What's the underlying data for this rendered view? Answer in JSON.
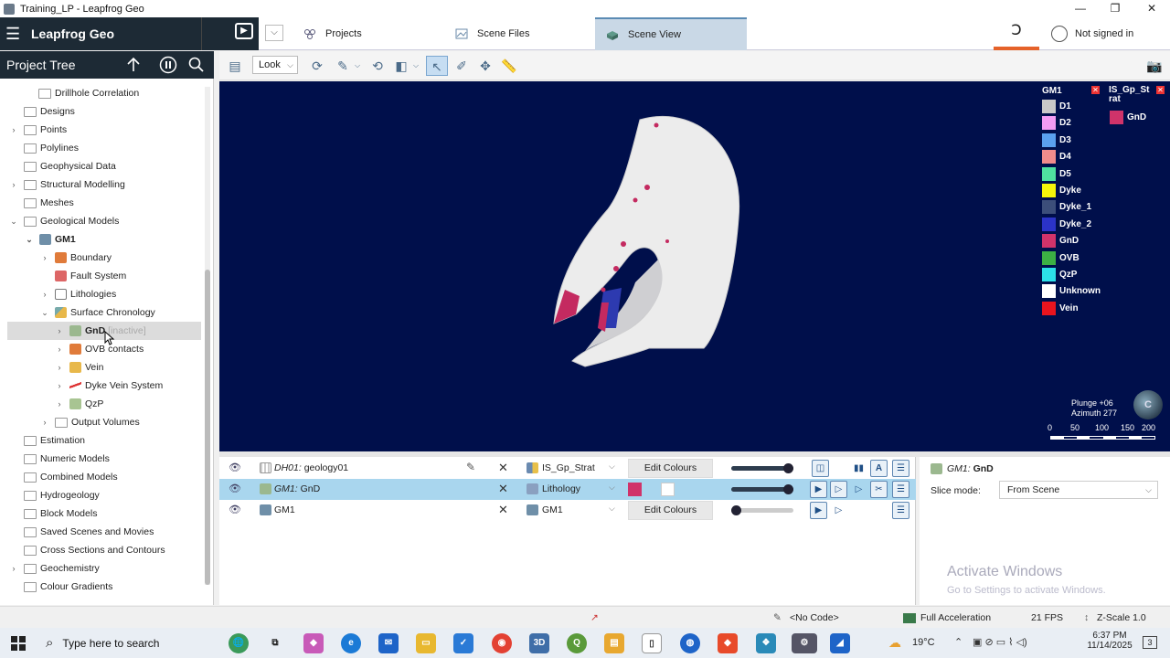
{
  "window": {
    "title": "Training_LP - Leapfrog Geo",
    "min": "—",
    "max": "❐",
    "close": "✕"
  },
  "header": {
    "app_name": "Leapfrog Geo",
    "tabs": [
      {
        "label": "Projects"
      },
      {
        "label": "Scene Files"
      },
      {
        "label": "Scene View"
      }
    ],
    "signin": "Not signed in"
  },
  "project_tree": {
    "title": "Project Tree",
    "items": [
      {
        "label": "Drillhole Correlation"
      },
      {
        "label": "Designs"
      },
      {
        "label": "Points"
      },
      {
        "label": "Polylines"
      },
      {
        "label": "Geophysical Data"
      },
      {
        "label": "Structural Modelling"
      },
      {
        "label": "Meshes"
      },
      {
        "label": "Geological Models"
      },
      {
        "label": "GM1"
      },
      {
        "label": "Boundary"
      },
      {
        "label": "Fault System"
      },
      {
        "label": "Lithologies"
      },
      {
        "label": "Surface Chronology"
      },
      {
        "label": "GnD",
        "suffix": "[inactive]"
      },
      {
        "label": "OVB contacts"
      },
      {
        "label": "Vein"
      },
      {
        "label": "Dyke Vein System"
      },
      {
        "label": "QzP"
      },
      {
        "label": "Output Volumes"
      },
      {
        "label": "Estimation"
      },
      {
        "label": "Numeric Models"
      },
      {
        "label": "Combined Models"
      },
      {
        "label": "Hydrogeology"
      },
      {
        "label": "Block Models"
      },
      {
        "label": "Saved Scenes and Movies"
      },
      {
        "label": "Cross Sections and Contours"
      },
      {
        "label": "Geochemistry"
      },
      {
        "label": "Colour Gradients"
      }
    ]
  },
  "toolbar": {
    "look": "Look"
  },
  "legend": {
    "gm1_title": "GM1",
    "strat_title": "IS_Gp_St rat",
    "gm1_items": [
      {
        "label": "D1",
        "color": "#c8c8c8"
      },
      {
        "label": "D2",
        "color": "#f39cf3"
      },
      {
        "label": "D3",
        "color": "#5aa0ee"
      },
      {
        "label": "D4",
        "color": "#f08c8c"
      },
      {
        "label": "D5",
        "color": "#4fe0a0"
      },
      {
        "label": "Dyke",
        "color": "#f5f50a"
      },
      {
        "label": "Dyke_1",
        "color": "#3c4e7a"
      },
      {
        "label": "Dyke_2",
        "color": "#2b33c8"
      },
      {
        "label": "GnD",
        "color": "#d0336a"
      },
      {
        "label": "OVB",
        "color": "#3cb044"
      },
      {
        "label": "QzP",
        "color": "#2ce0e8"
      },
      {
        "label": "Unknown",
        "color": "#ffffff"
      },
      {
        "label": "Vein",
        "color": "#e8141e"
      }
    ],
    "strat_items": [
      {
        "label": "GnD",
        "color": "#d0336a"
      }
    ]
  },
  "view": {
    "plunge": "Plunge +06",
    "azimuth": "Azimuth 277",
    "scale_ticks": [
      "0",
      "50",
      "100",
      "150",
      "200"
    ],
    "globe": "C"
  },
  "scene_list": [
    {
      "name_prefix": "DH01:",
      "name": "geology01",
      "colour_by": "IS_Gp_Strat",
      "button": "Edit Colours",
      "slider": 1.0
    },
    {
      "name_prefix": "GM1:",
      "name": "GnD",
      "colour_by": "Lithology",
      "button": "",
      "slider": 1.0
    },
    {
      "name_prefix": "",
      "name": "GM1",
      "colour_by": "GM1",
      "button": "Edit Colours",
      "slider": 0.0
    }
  ],
  "properties": {
    "title_prefix": "GM1:",
    "title": "GnD",
    "slice_mode_label": "Slice mode:",
    "slice_mode_value": "From Scene"
  },
  "watermark": {
    "line1": "Activate Windows",
    "line2": "Go to Settings to activate Windows."
  },
  "statusbar": {
    "code": "<No Code>",
    "accel": "Full Acceleration",
    "fps": "21 FPS",
    "zscale": "Z-Scale 1.0"
  },
  "taskbar": {
    "search": "Type here to search",
    "temp": "19°C",
    "time": "6:37 PM",
    "date": "11/14/2025",
    "notif": "3"
  }
}
